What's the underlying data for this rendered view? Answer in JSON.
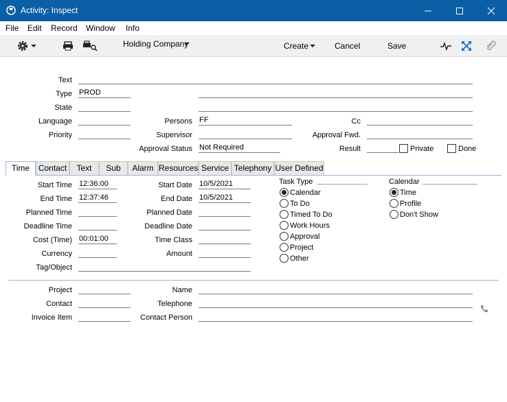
{
  "window": {
    "title": "Activity: Inspect"
  },
  "menu": [
    "File",
    "Edit",
    "Record",
    "Window",
    "Info"
  ],
  "toolbar": {
    "company": "Holding Company",
    "create": "Create",
    "cancel": "Cancel",
    "save": "Save"
  },
  "header": {
    "text_label": "Text",
    "text_value": "",
    "type_label": "Type",
    "type_value": "PROD",
    "type_desc": "",
    "state_label": "State",
    "state_value": "",
    "state_desc": "",
    "language_label": "Language",
    "language_value": "",
    "persons_label": "Persons",
    "persons_value": "FF",
    "cc_label": "Cc",
    "cc_value": "",
    "priority_label": "Priority",
    "priority_value": "",
    "supervisor_label": "Supervisor",
    "supervisor_value": "",
    "approval_fwd_label": "Approval Fwd.",
    "approval_fwd_value": "",
    "approval_status_label": "Approval Status",
    "approval_status_value": "Not Required",
    "result_label": "Result",
    "result_value": "",
    "private_label": "Private",
    "done_label": "Done"
  },
  "tabs": [
    "Time",
    "Contact",
    "Text",
    "Sub",
    "Alarm",
    "Resources",
    "Service",
    "Telephony",
    "User Defined"
  ],
  "time_tab": {
    "start_time_label": "Start Time",
    "start_time": "12:36:00",
    "end_time_label": "End Time",
    "end_time": "12:37:46",
    "planned_time_label": "Planned Time",
    "planned_time": "",
    "deadline_time_label": "Deadline Time",
    "deadline_time": "",
    "cost_time_label": "Cost (Time)",
    "cost_time": "00:01:00",
    "currency_label": "Currency",
    "currency": "",
    "tag_label": "Tag/Object",
    "tag": "",
    "start_date_label": "Start Date",
    "start_date": "10/5/2021",
    "end_date_label": "End Date",
    "end_date": "10/5/2021",
    "planned_date_label": "Planned Date",
    "planned_date": "",
    "deadline_date_label": "Deadline Date",
    "deadline_date": "",
    "time_class_label": "Time Class",
    "time_class": "",
    "amount_label": "Amount",
    "amount": "",
    "task_type_title": "Task Type",
    "task_type_options": [
      "Calendar",
      "To Do",
      "Timed To Do",
      "Work Hours",
      "Approval",
      "Project",
      "Other"
    ],
    "calendar_title": "Calendar",
    "calendar_options": [
      "Time",
      "Profile",
      "Don't Show"
    ]
  },
  "footer": {
    "project_label": "Project",
    "project": "",
    "contact_label": "Contact",
    "contact": "",
    "invoice_item_label": "Invoice Item",
    "invoice_item": "",
    "name_label": "Name",
    "name": "",
    "telephone_label": "Telephone",
    "telephone": "",
    "contact_person_label": "Contact Person",
    "contact_person": ""
  }
}
